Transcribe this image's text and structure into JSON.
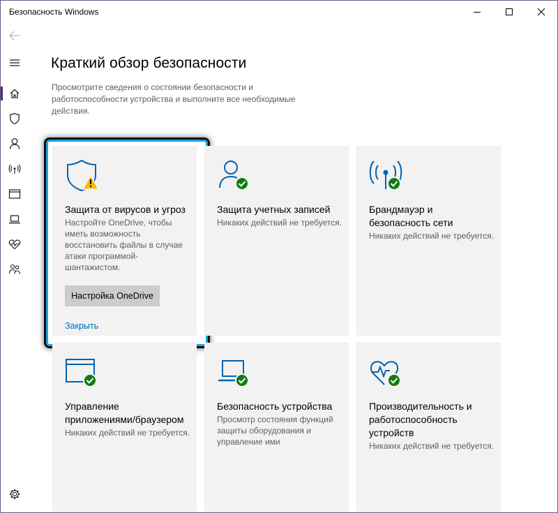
{
  "window": {
    "title": "Безопасность Windows",
    "accent_color": "#0063b1",
    "ok_color": "#107c10",
    "warning_color": "#ffb900"
  },
  "sidebar": {
    "items": [
      {
        "name": "back",
        "icon": "back-arrow-icon"
      },
      {
        "name": "menu",
        "icon": "hamburger-menu-icon"
      },
      {
        "name": "home",
        "icon": "home-icon",
        "active": true
      },
      {
        "name": "virus",
        "icon": "shield-icon"
      },
      {
        "name": "account",
        "icon": "person-icon"
      },
      {
        "name": "firewall",
        "icon": "wifi-signal-icon"
      },
      {
        "name": "app-browser",
        "icon": "browser-window-icon"
      },
      {
        "name": "device",
        "icon": "laptop-icon"
      },
      {
        "name": "health",
        "icon": "heart-pulse-icon"
      },
      {
        "name": "family",
        "icon": "family-icon"
      },
      {
        "name": "settings",
        "icon": "gear-icon"
      }
    ]
  },
  "main": {
    "title": "Краткий обзор безопасности",
    "description": "Просмотрите сведения о состоянии безопасности и работоспособности устройства и выполните все необходимые действия."
  },
  "tiles": [
    {
      "id": "virus",
      "icon": "shield-warning-icon",
      "title": "Защита от вирусов и угроз",
      "subtitle": "Настройте OneDrive, чтобы иметь возможность восстановить файлы в случае атаки программой-шантажистом.",
      "button_label": "Настройка OneDrive",
      "link_label": "Закрыть"
    },
    {
      "id": "account",
      "icon": "person-check-icon",
      "title": "Защита учетных записей",
      "subtitle": "Никаких действий не требуется."
    },
    {
      "id": "firewall",
      "icon": "wifi-check-icon",
      "title": "Брандмауэр и безопасность сети",
      "subtitle": "Никаких действий не требуется."
    },
    {
      "id": "app-browser",
      "icon": "browser-check-icon",
      "title": "Управление приложениями/браузером",
      "subtitle": "Никаких действий не требуется."
    },
    {
      "id": "device",
      "icon": "laptop-check-icon",
      "title": "Безопасность устройства",
      "subtitle": "Просмотр состояния функций защиты оборудования и управление ими"
    },
    {
      "id": "health",
      "icon": "heart-check-icon",
      "title": "Производительность и работоспособность устройств",
      "subtitle": "Никаких действий не требуется."
    }
  ]
}
